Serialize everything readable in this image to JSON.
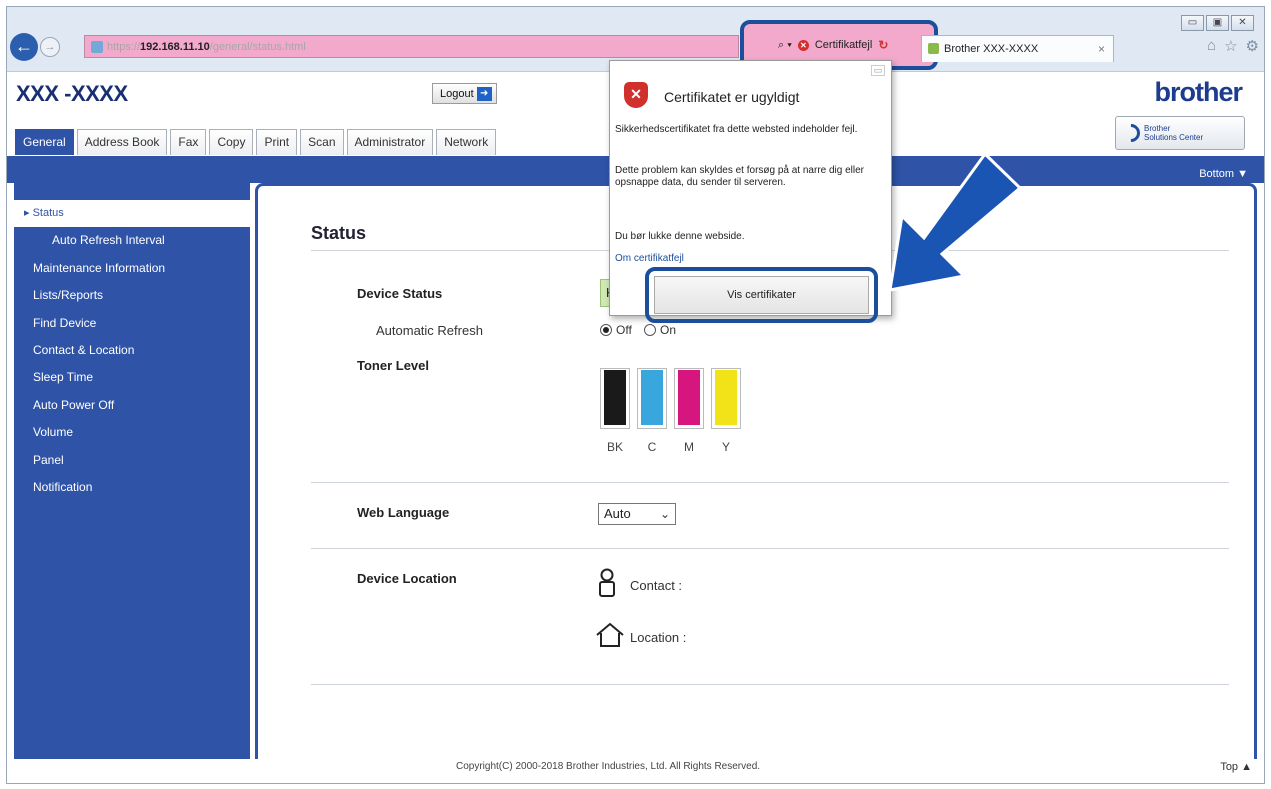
{
  "browser": {
    "url_scheme": "https://",
    "url_host": "192.168.11.10",
    "url_path": "/general/status.html",
    "search_label": "⌕ ▾",
    "cert_error_label": "Certifikatfejl",
    "tab_title": "Brother XXX-XXXX",
    "tab_close": "×",
    "window_controls": [
      "▭",
      "▣",
      "✕"
    ],
    "toolbar_icons": [
      "home-icon",
      "star-icon",
      "gear-icon"
    ]
  },
  "header": {
    "model": "XXX -XXXX",
    "logout_label": "Logout",
    "brand": "brother",
    "solutions_line1": "Brother",
    "solutions_line2": "Solutions Center",
    "bottom_link": "Bottom ▼"
  },
  "tabs": [
    {
      "label": "General",
      "active": true
    },
    {
      "label": "Address Book"
    },
    {
      "label": "Fax"
    },
    {
      "label": "Copy"
    },
    {
      "label": "Print"
    },
    {
      "label": "Scan"
    },
    {
      "label": "Administrator"
    },
    {
      "label": "Network"
    }
  ],
  "sidebar": {
    "items": [
      {
        "label": "▸ Status"
      },
      {
        "label": "Auto Refresh Interval"
      },
      {
        "label": "Maintenance Information"
      },
      {
        "label": "Lists/Reports"
      },
      {
        "label": "Find Device"
      },
      {
        "label": "Contact & Location"
      },
      {
        "label": "Sleep Time"
      },
      {
        "label": "Auto Power Off"
      },
      {
        "label": "Volume"
      },
      {
        "label": "Panel"
      },
      {
        "label": "Notification"
      }
    ]
  },
  "main": {
    "title": "Status",
    "device_status_label": "Device Status",
    "device_status_value": "K",
    "auto_refresh_label": "Automatic Refresh",
    "refresh_off": "Off",
    "refresh_on": "On",
    "refresh_selected": "Off",
    "toner_label": "Toner Level",
    "toner": [
      {
        "name": "BK",
        "color": "#1a1a1a",
        "level": 1.0
      },
      {
        "name": "C",
        "color": "#3aa6de",
        "level": 1.0
      },
      {
        "name": "M",
        "color": "#d6157f",
        "level": 1.0
      },
      {
        "name": "Y",
        "color": "#f2e218",
        "level": 1.0
      }
    ],
    "web_language_label": "Web Language",
    "web_language_value": "Auto",
    "device_location_label": "Device Location",
    "contact_label": "Contact :",
    "location_label": "Location :"
  },
  "footer": {
    "copyright": "Copyright(C) 2000-2018 Brother Industries, Ltd. All Rights Reserved.",
    "top_link": "Top ▲"
  },
  "cert_popup": {
    "title": "Certifikatet er ugyldigt",
    "p1": "Sikkerhedscertifikatet fra dette websted indeholder fejl.",
    "p2": "Dette problem kan skyldes et forsøg på at narre dig eller opsnappe data, du sender til serveren.",
    "p3": "Du bør lukke denne webside.",
    "link": "Om certifikatfejl",
    "button": "Vis certifikater"
  },
  "colors": {
    "brand_blue": "#2e53a7",
    "highlight": "#1b4f9c",
    "address_error": "#f2a9cc"
  }
}
